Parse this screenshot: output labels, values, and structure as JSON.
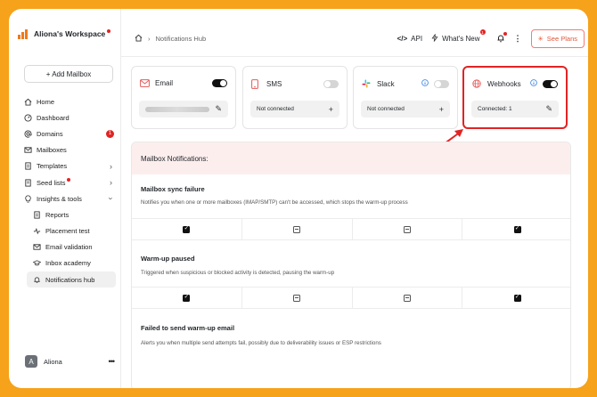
{
  "sidebar": {
    "workspace_name": "Aliona's Workspace",
    "add_mailbox_label": "+ Add Mailbox",
    "items": [
      {
        "label": "Home"
      },
      {
        "label": "Dashboard"
      },
      {
        "label": "Domains",
        "badge": "1"
      },
      {
        "label": "Mailboxes"
      },
      {
        "label": "Templates"
      },
      {
        "label": "Seed lists"
      },
      {
        "label": "Insights & tools"
      },
      {
        "label": "Reports"
      },
      {
        "label": "Placement test"
      },
      {
        "label": "Email validation"
      },
      {
        "label": "Inbox academy"
      },
      {
        "label": "Notifications hub"
      }
    ],
    "user": {
      "initial": "A",
      "name": "Aliona",
      "more": "•••"
    }
  },
  "topbar": {
    "breadcrumb_page": "Notifications Hub",
    "api_label": "API",
    "whats_new_label": "What's New",
    "whats_new_badge": "1",
    "see_plans_label": "See Plans"
  },
  "channels": [
    {
      "name": "Email",
      "enabled": true,
      "status": ""
    },
    {
      "name": "SMS",
      "enabled": false,
      "status": "Not connected"
    },
    {
      "name": "Slack",
      "enabled": false,
      "status": "Not connected"
    },
    {
      "name": "Webhooks",
      "enabled": true,
      "status": "Connected: 1"
    }
  ],
  "panel": {
    "title": "Mailbox Notifications:",
    "sections": [
      {
        "title": "Mailbox sync failure",
        "description": "Notifies you when one or more mailboxes (IMAP/SMTP) can't be accessed, which stops the warm-up process",
        "checks": [
          "checked",
          "partial",
          "partial",
          "checked"
        ]
      },
      {
        "title": "Warm-up paused",
        "description": "Triggered when suspicious or blocked activity is detected, pausing the warm-up",
        "checks": [
          "checked",
          "partial",
          "partial",
          "checked"
        ]
      },
      {
        "title": "Failed to send warm-up email",
        "description": "Alerts you when multiple send attempts fail, possibly due to deliverability issues or ESP restrictions"
      }
    ]
  },
  "colors": {
    "accent": "#f6a21a",
    "highlight": "#e02424",
    "panel_head_bg": "#fdeeee"
  }
}
